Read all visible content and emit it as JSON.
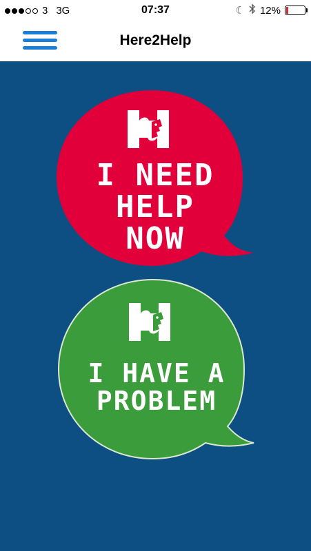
{
  "status_bar": {
    "carrier": "3",
    "network": "3G",
    "time": "07:37",
    "battery_percent": "12%",
    "battery_level": 0.12
  },
  "nav": {
    "title": "Here2Help",
    "menu_icon": "hamburger-menu-icon"
  },
  "main": {
    "background": "#0d4f82",
    "need_help": {
      "line1": "I NEED",
      "line2": "HELP",
      "line3": "NOW",
      "color": "#e2003b"
    },
    "have_problem": {
      "line1": "I HAVE A",
      "line2": "PROBLEM",
      "color": "#3a9c3a"
    },
    "logo_icon": "here2help-puzzle-logo"
  }
}
